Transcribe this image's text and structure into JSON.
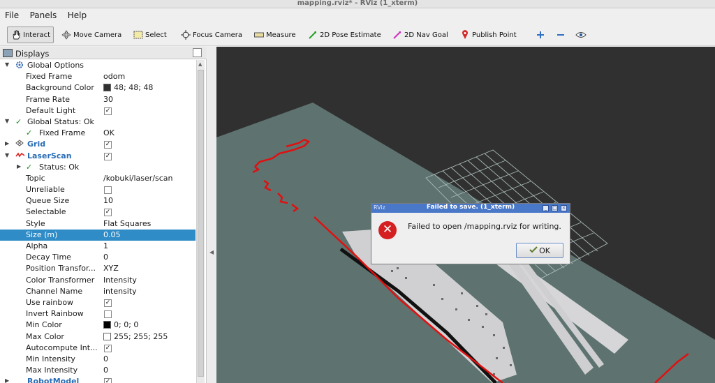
{
  "window": {
    "title": "mapping.rviz* - RViz (1_xterm)"
  },
  "menu": [
    "File",
    "Panels",
    "Help"
  ],
  "toolbar": {
    "interact": "Interact",
    "move_camera": "Move Camera",
    "select": "Select",
    "focus_camera": "Focus Camera",
    "measure": "Measure",
    "pose_estimate": "2D Pose Estimate",
    "nav_goal": "2D Nav Goal",
    "publish_point": "Publish Point"
  },
  "panel": {
    "title": "Displays"
  },
  "tree": [
    {
      "name": "global-options",
      "label": "Global Options",
      "value": ""
    },
    {
      "name": "fixed-frame",
      "label": "Fixed Frame",
      "value": "odom"
    },
    {
      "name": "background-color",
      "label": "Background Color",
      "value": "48; 48; 48",
      "swatch": "#303030"
    },
    {
      "name": "frame-rate",
      "label": "Frame Rate",
      "value": "30"
    },
    {
      "name": "default-light",
      "label": "Default Light",
      "value": ""
    },
    {
      "name": "global-status",
      "label": "Global Status: Ok",
      "value": ""
    },
    {
      "name": "status-fixed-frame",
      "label": "Fixed Frame",
      "value": "OK"
    },
    {
      "name": "grid",
      "label": "Grid",
      "value": ""
    },
    {
      "name": "laserscan",
      "label": "LaserScan",
      "value": ""
    },
    {
      "name": "laser-status",
      "label": "Status: Ok",
      "value": ""
    },
    {
      "name": "topic",
      "label": "Topic",
      "value": "/kobuki/laser/scan"
    },
    {
      "name": "unreliable",
      "label": "Unreliable",
      "value": ""
    },
    {
      "name": "queue-size",
      "label": "Queue Size",
      "value": "10"
    },
    {
      "name": "selectable",
      "label": "Selectable",
      "value": ""
    },
    {
      "name": "style",
      "label": "Style",
      "value": "Flat Squares"
    },
    {
      "name": "size",
      "label": "Size (m)",
      "value": "0.05"
    },
    {
      "name": "alpha",
      "label": "Alpha",
      "value": "1"
    },
    {
      "name": "decay-time",
      "label": "Decay Time",
      "value": "0"
    },
    {
      "name": "position-transformer",
      "label": "Position Transfor...",
      "value": "XYZ"
    },
    {
      "name": "color-transformer",
      "label": "Color Transformer",
      "value": "Intensity"
    },
    {
      "name": "channel-name",
      "label": "Channel Name",
      "value": "intensity"
    },
    {
      "name": "use-rainbow",
      "label": "Use rainbow",
      "value": ""
    },
    {
      "name": "invert-rainbow",
      "label": "Invert Rainbow",
      "value": ""
    },
    {
      "name": "min-color",
      "label": "Min Color",
      "value": "0; 0; 0",
      "swatch": "#000000"
    },
    {
      "name": "max-color",
      "label": "Max Color",
      "value": "255; 255; 255",
      "swatch": "#ffffff"
    },
    {
      "name": "autocompute-intensity",
      "label": "Autocompute Int...",
      "value": ""
    },
    {
      "name": "min-intensity",
      "label": "Min Intensity",
      "value": "0"
    },
    {
      "name": "max-intensity",
      "label": "Max Intensity",
      "value": "0"
    },
    {
      "name": "robotmodel",
      "label": "RobotModel",
      "value": ""
    }
  ],
  "dialog": {
    "title": "Failed to save. (1_xterm)",
    "logo": "RViz",
    "message": "Failed to open /mapping.rviz for writing.",
    "ok_label": "OK"
  },
  "colors": {
    "selection": "#308cc6",
    "view_background": "#303030",
    "ground": "#5e7370",
    "scan": "#e01010"
  },
  "icons": [
    "hand-icon",
    "move-camera-icon",
    "select-icon",
    "focus-camera-icon",
    "measure-icon",
    "pose-estimate-icon",
    "nav-goal-icon",
    "publish-point-icon",
    "zoom-in-icon",
    "zoom-out-icon",
    "eye-icon",
    "error-icon"
  ]
}
